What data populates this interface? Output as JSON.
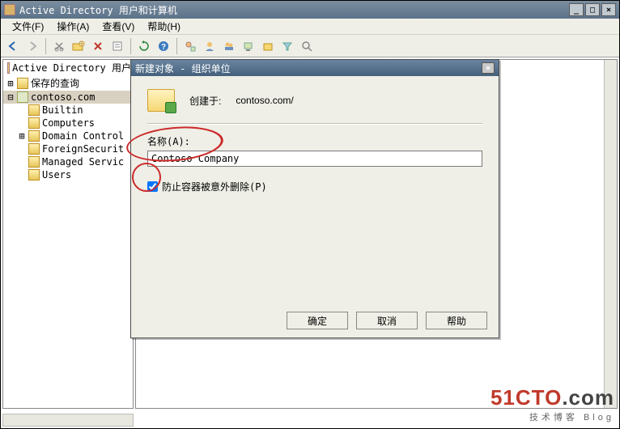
{
  "window": {
    "title": "Active Directory 用户和计算机",
    "min": "_",
    "max": "□",
    "close": "×"
  },
  "menu": {
    "file": "文件(F)",
    "action": "操作(A)",
    "view": "查看(V)",
    "help": "帮助(H)"
  },
  "tree": {
    "root": "Active Directory 用户",
    "saved": "保存的查询",
    "domain": "contoso.com",
    "children": {
      "builtin": "Builtin",
      "computers": "Computers",
      "domainctrl": "Domain Control",
      "foreign": "ForeignSecurit",
      "managed": "Managed Servic",
      "users": "Users"
    }
  },
  "dialog": {
    "title": "新建对象 - 组织单位",
    "created_label": "创建于:",
    "created_path": "contoso.com/",
    "name_label": "名称(A):",
    "name_value": "Contoso Company",
    "protect_label": "防止容器被意外删除(P)",
    "protect_checked": true,
    "ok": "确定",
    "cancel": "取消",
    "help": "帮助",
    "close": "×"
  },
  "watermark": {
    "brand_prefix": "51CTO",
    "brand_suffix": ".com",
    "tag": "技术博客",
    "tag2": "Blog"
  }
}
